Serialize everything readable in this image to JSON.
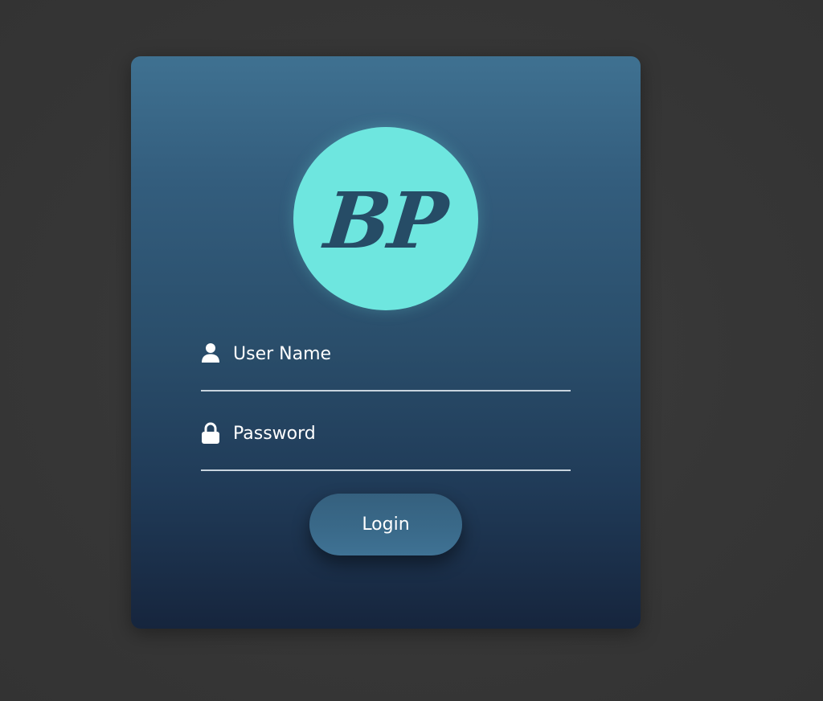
{
  "logo": {
    "text": "BP",
    "circle_color": "#6ee6df",
    "text_color": "#264c66"
  },
  "form": {
    "username": {
      "label": "User Name",
      "icon": "user-icon"
    },
    "password": {
      "label": "Password",
      "icon": "lock-icon"
    },
    "login_label": "Login"
  },
  "colors": {
    "card_top": "#3f7191",
    "card_bottom": "#16253d",
    "background": "#383838",
    "text": "#ffffff"
  }
}
